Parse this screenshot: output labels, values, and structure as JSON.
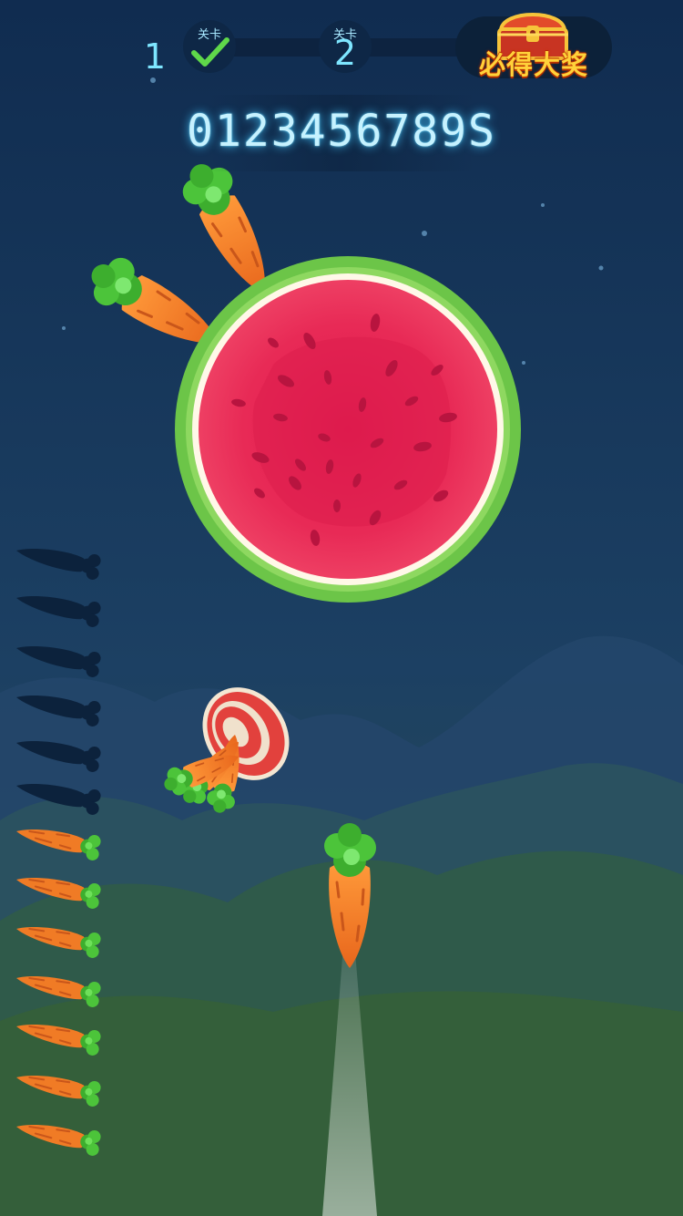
{
  "hud": {
    "completed_level": "1",
    "level_label_1": "关卡",
    "level_label_2": "关卡",
    "next_level": "2",
    "prize_text": "必得大奖",
    "timer": "0123456789S"
  },
  "game": {
    "stuck_carrots": 2,
    "carrots_total": 13,
    "carrots_used": 6,
    "carrots_remaining": 7
  },
  "icons": {
    "checkmark": "check-icon",
    "prize": "treasure-chest-icon",
    "target": "watermelon-target",
    "bonus": "bonus-carrot-target"
  },
  "colors": {
    "sky_top": "#102c50",
    "sky_bottom": "#2c4d4a",
    "hud_text": "#7ee6ff",
    "carrot": "#f07b25",
    "carrot_leaf": "#4cc43a",
    "melon_flesh": "#e8385c",
    "melon_rind": "#6cc548",
    "prize_text": "#ffd23a"
  }
}
